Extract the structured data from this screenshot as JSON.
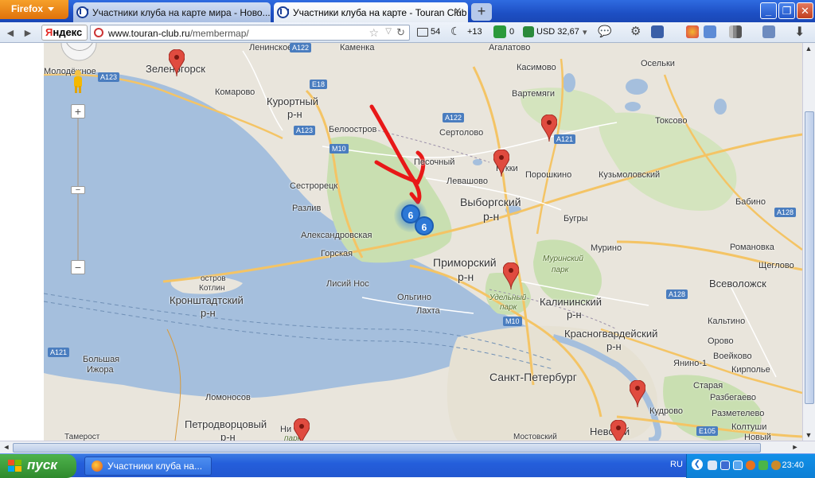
{
  "browser": {
    "menu_button": "Firefox",
    "tabs": [
      {
        "title": "Участники клуба на карте мира - Ново..."
      },
      {
        "title": "Участники клуба на карте - Touran Club"
      }
    ],
    "new_tab": "+",
    "window_buttons": {
      "minimize": "_",
      "maximize": "❐",
      "close": "✕"
    }
  },
  "navbar": {
    "back": "◄",
    "forward": "►",
    "yandex_label": [
      "Я",
      "ндекс"
    ],
    "url_domain": "www.touran-club.ru",
    "url_path": "/membermap/",
    "mail_count": "54",
    "weather": "+13",
    "status_count": "0",
    "currency": "USD 32,67"
  },
  "map": {
    "zoom_in": "+",
    "zoom_out": "−",
    "labels": [
      "Ленинское",
      "Каменка",
      "Агалатово",
      "Осельки",
      "Зеленогорск",
      "Молодёжное",
      "Комарово",
      "Касимово",
      "Вартемяги",
      "Курортный",
      "р-н",
      "Белоостров",
      "Сертолово",
      "Токсово",
      "Песочный",
      "Кукки",
      "Порошкино",
      "Кузьмоловский",
      "Левашово",
      "Сестрорецк",
      "Выборгский",
      "р-н",
      "Бугры",
      "Бабино",
      "Разлив",
      "Александровская",
      "Горская",
      "Мурино",
      "Романовка",
      "Приморский",
      "р-н",
      "Щеглово",
      "Муринский",
      "парк",
      "остров",
      "Котлин",
      "Лисий Нос",
      "Всеволожск",
      "Кронштадтский",
      "р-н",
      "Ольгино",
      "Удельный",
      "парк",
      "Калининский",
      "р-н",
      "Лахта",
      "Кальтино",
      "Красногвардейский",
      "р-н",
      "Орово",
      "Большая",
      "Ижора",
      "Воейково",
      "Янино-1",
      "Кирполье",
      "Санкт-Петербург",
      "Старая",
      "Ломоносов",
      "Разбегаево",
      "Кудрово",
      "Разметелево",
      "Петродворцовый",
      "р-н",
      "Ни",
      "парк",
      "Невский",
      "Мостовский",
      "Тамерост",
      "Колтуши",
      "Hовый"
    ],
    "roads": [
      "A123",
      "A122",
      "E18",
      "A123",
      "M10",
      "A122",
      "A121",
      "A128",
      "M10",
      "A128",
      "A121",
      "M10",
      "E105"
    ],
    "clusters": [
      "6",
      "6"
    ]
  },
  "taskbar": {
    "start": "пуск",
    "app": "Участники клуба на...",
    "lang": "RU",
    "clock": "23:40"
  },
  "colors": {
    "water": "#a5bfdd",
    "land": "#e9e5dc",
    "park": "#c9dfb1",
    "arrow": "#e81818",
    "cluster": "#2d78d6",
    "marker": "#e04b3f"
  }
}
